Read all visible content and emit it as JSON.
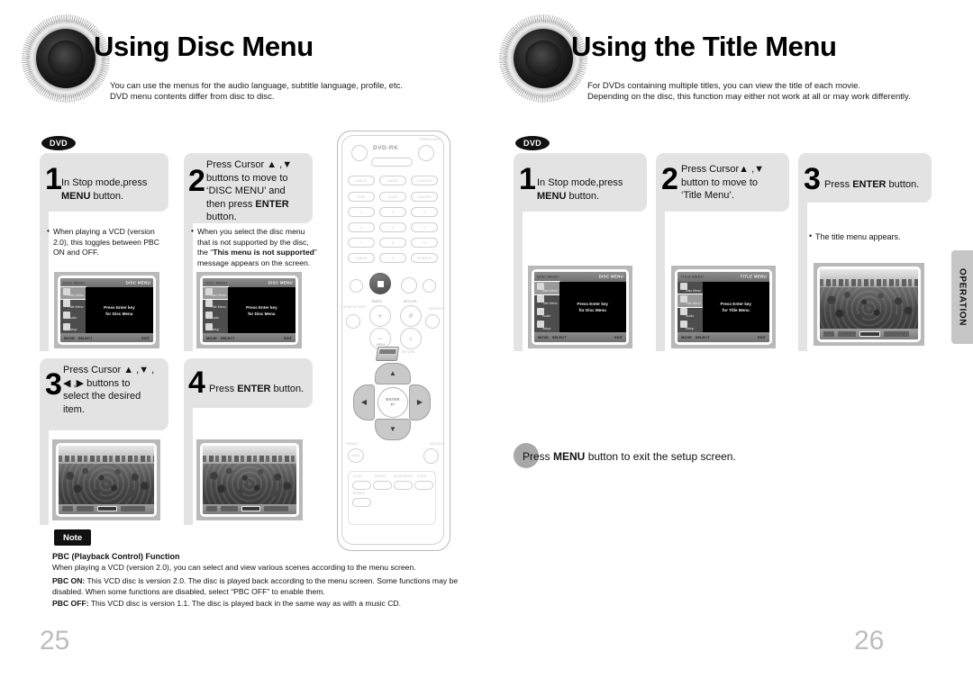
{
  "left_page": {
    "page_number": "25",
    "header": {
      "title": "Using Disc Menu",
      "sub_line1": "You can use the menus for the audio language, subtitle language, profile, etc.",
      "sub_line2": "DVD menu contents differ from disc to disc."
    },
    "disc_badge": "DVD",
    "steps": [
      {
        "number": "1",
        "text_line1": "In Stop mode,press",
        "text_bold": "MENU",
        "text_line2": " button.",
        "bullet": "When playing a VCD (version 2.0), this toggles between PBC ON and OFF."
      },
      {
        "number": "2",
        "text_line1": "Press Cursor ▲ ,▼",
        "text_line2": "buttons to move to",
        "text_line3": "‘DISC MENU’ and",
        "text_line4": "then press ",
        "text_bold": "ENTER",
        "text_line5": "button.",
        "bullet_pre": "When you select the disc menu that is not supported by the disc, the “",
        "bullet_bold": "This menu is not supported",
        "bullet_post": "” message appears on the screen."
      },
      {
        "number": "3",
        "text_line1": "Press Cursor ▲ ,▼ ,",
        "text_line2": "◀ ,▶ buttons to",
        "text_line3": "select the desired",
        "text_line4": "item."
      },
      {
        "number": "4",
        "text_line1": "Press ",
        "text_bold": "ENTER",
        "text_line2": " button."
      }
    ],
    "osd": {
      "header_left": "DISC MENU",
      "header_right": "DISC MENU",
      "items": [
        "Disc Menu",
        "Title Menu",
        "Audio",
        "Setup"
      ],
      "body_line1": "Press Enter key",
      "body_line2": "for Disc Menu",
      "footer_move": "MOVE",
      "footer_select": "SELECT",
      "footer_exit": "EXIT"
    },
    "note": {
      "tag": "Note",
      "heading": "PBC (Playback Control) Function",
      "intro": "When playing a VCD (version 2.0), you can select and view various scenes according to the menu screen.",
      "pbc_on_label": "PBC ON:",
      "pbc_on_text": "This VCD disc is version 2.0. The disc is played back according to the menu screen. Some functions may be disabled. When some functions are disabled, select “PBC OFF” to enable them.",
      "pbc_off_label": "PBC OFF:",
      "pbc_off_text": "This VCD disc is version 1.1. The disc is played back in the same way as with a music CD."
    }
  },
  "right_page": {
    "page_number": "26",
    "header": {
      "title": "Using the Title Menu",
      "sub_line1": "For DVDs containing multiple titles, you can view the title of each movie.",
      "sub_line2": "Depending on the disc, this function may either not work at all or may work differently."
    },
    "disc_badge": "DVD",
    "steps": [
      {
        "number": "1",
        "text_line1": "In Stop mode,press",
        "text_bold": "MENU",
        "text_line2": " button."
      },
      {
        "number": "2",
        "text_line1": "Press Cursor▲ ,▼",
        "text_line2": "button to move to",
        "text_line3": "‘Title Menu’."
      },
      {
        "number": "3",
        "text_line1": "Press ",
        "text_bold": "ENTER",
        "text_line2": " button.",
        "bullet": "The title menu appears."
      }
    ],
    "osd_disc": {
      "header_left": "DISC MENU",
      "header_right": "DISC MENU",
      "items": [
        "Disc Menu",
        "Title Menu",
        "Audio",
        "Setup"
      ],
      "body_line1": "Press Enter key",
      "body_line2": "for Disc Menu",
      "footer_move": "MOVE",
      "footer_select": "SELECT",
      "footer_exit": "EXIT"
    },
    "osd_title": {
      "header_left": "TITLE MENU",
      "header_right": "TITLE MENU",
      "items": [
        "Disc Menu",
        "Title Menu",
        "Audio",
        "Setup"
      ],
      "body_line1": "Press Enter key",
      "body_line2": "for Title Menu",
      "footer_move": "MOVE",
      "footer_select": "SELECT",
      "footer_exit": "EXIT"
    },
    "exit_note": {
      "pre": "Press ",
      "bold": "MENU",
      "post": " button to exit the setup screen."
    },
    "side_tab": "OPERATION"
  },
  "remote": {
    "brand": "DVD-RK",
    "labels": {
      "power": "POWER",
      "open_close": "OPEN/CLOSE",
      "cancel_top": "CANCEL",
      "audio": "AUDIO",
      "subtitle": "SUBTITLE",
      "step": "STEP",
      "slow": "SLOW",
      "dvd_vcd": "DVD/VCD",
      "num1": "1",
      "num2": "2",
      "num3": "3",
      "num4": "4",
      "num5": "5",
      "num6": "6",
      "num7": "7",
      "num8": "8",
      "num9": "9",
      "cancel": "CANCEL",
      "num0": "0",
      "reserve": "RESERVE",
      "tempo": "TEMPO",
      "keycon": "KEYCON",
      "search_song": "SEARCH SONG",
      "favorite": "FAVORITE",
      "menu": "MENU",
      "return": "RETURN",
      "female": "FEMALE",
      "male": "MALE",
      "melody": "MELODY",
      "enter": "ENTER",
      "logo": "LOGO",
      "digest": "DIGEST",
      "slideshow": "SLIDE MODE",
      "zoom": "ZOOM",
      "repeat": "REPEAT"
    }
  }
}
